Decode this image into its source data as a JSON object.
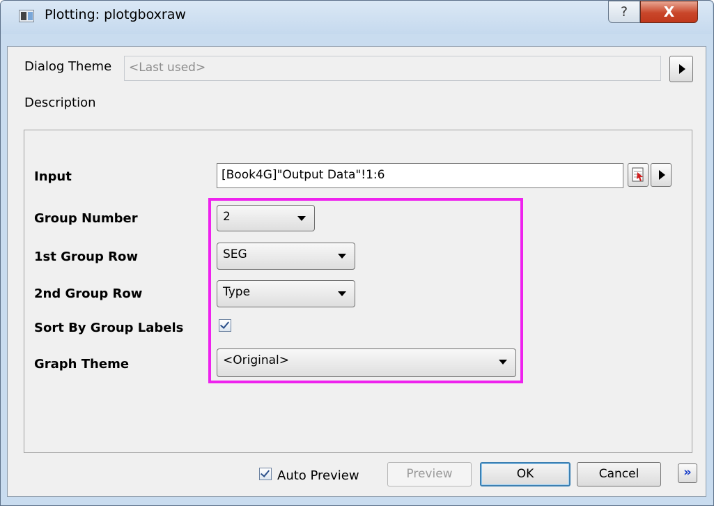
{
  "window": {
    "title": "Plotting: plotgboxraw",
    "help_glyph": "?",
    "close_glyph": "X"
  },
  "dialog_theme": {
    "label": "Dialog Theme",
    "value": "<Last used>"
  },
  "description": {
    "label": "Description"
  },
  "form": {
    "input": {
      "label": "Input",
      "value": "[Book4G]\"Output Data\"!1:6"
    },
    "group_number": {
      "label": "Group Number",
      "value": "2"
    },
    "first_group_row": {
      "label": "1st Group Row",
      "value": "SEG"
    },
    "second_group_row": {
      "label": "2nd Group Row",
      "value": "Type"
    },
    "sort_by_group_labels": {
      "label": "Sort By Group Labels",
      "checked": true
    },
    "graph_theme": {
      "label": "Graph Theme",
      "value": "<Original>"
    }
  },
  "footer": {
    "auto_preview_label": "Auto Preview",
    "auto_preview_checked": true,
    "preview_label": "Preview",
    "ok_label": "OK",
    "cancel_label": "Cancel",
    "more_glyph": "»"
  },
  "colors": {
    "highlight_border": "#ee22ee",
    "close_button": "#c9462a",
    "titlebar": "#c9dcef"
  }
}
